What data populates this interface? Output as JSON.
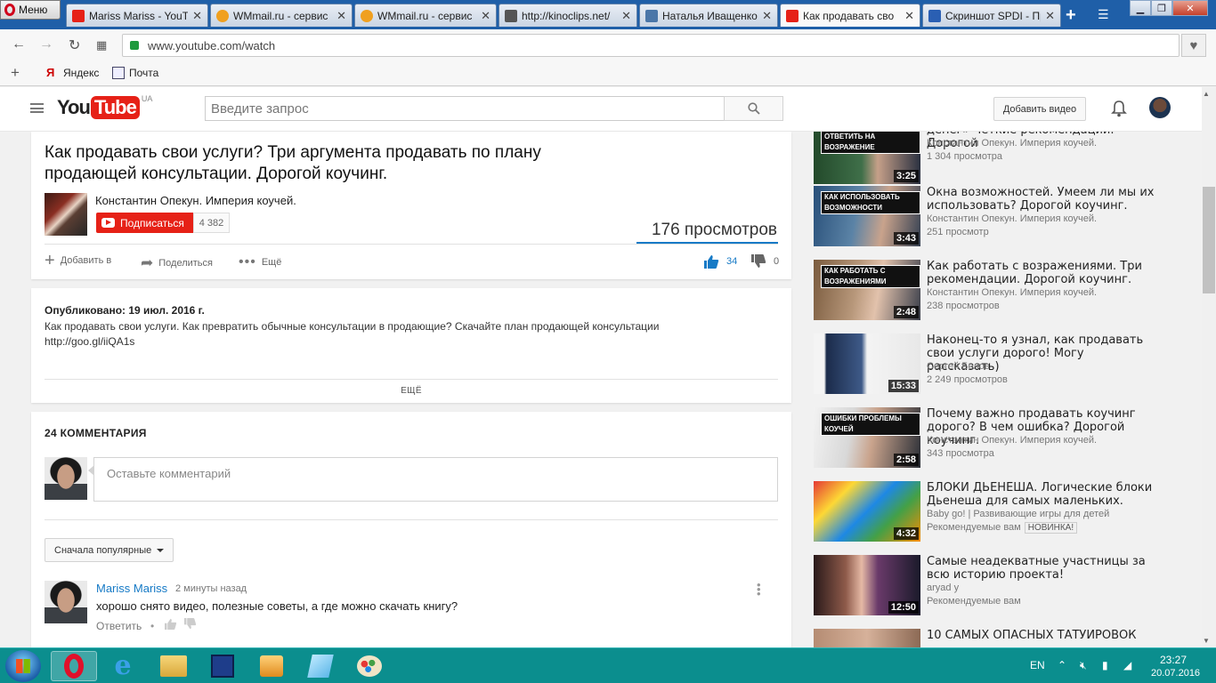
{
  "browser": {
    "menu_label": "Меню",
    "tabs": [
      {
        "label": "Mariss Mariss - YouT",
        "favicon": "youtube-icon",
        "color": "#e62117"
      },
      {
        "label": "WMmail.ru - сервис",
        "favicon": "wmmail-icon",
        "color": "#f0a020"
      },
      {
        "label": "WMmail.ru - сервис",
        "favicon": "wmmail-icon",
        "color": "#f0a020"
      },
      {
        "label": "http://kinoclips.net/",
        "favicon": "kinoclips-icon",
        "color": "#555555"
      },
      {
        "label": "Наталья Иващенко",
        "favicon": "vk-icon",
        "color": "#4a76a8"
      },
      {
        "label": "Как продавать сво",
        "favicon": "youtube-icon",
        "color": "#e62117"
      },
      {
        "label": "Скриншот SPDI - Пр",
        "favicon": "p-icon",
        "color": "#2a5fb3"
      }
    ],
    "active_tab_index": 5,
    "url": "www.youtube.com/watch",
    "bookmarks": [
      {
        "label": "Яндекс",
        "icon": "yandex-icon"
      },
      {
        "label": "Почта",
        "icon": "mail-icon"
      }
    ]
  },
  "youtube": {
    "logo_you": "You",
    "logo_tube": "Tube",
    "logo_region": "UA",
    "search_placeholder": "Введите запрос",
    "upload_label": "Добавить видео",
    "brand_color": "#e62117",
    "link_color": "#167ac6"
  },
  "video": {
    "title": "Как продавать свои услуги? Три аргумента продавать по плану продающей консультации. Дорогой коучинг.",
    "channel": "Константин Опекун. Империя коучей.",
    "subscribe_label": "Подписаться",
    "subscriber_count": "4 382",
    "views": "176 просмотров",
    "actions": {
      "add": "Добавить в",
      "share": "Поделиться",
      "more": "Ещё"
    },
    "likes": "34",
    "dislikes": "0",
    "like_ratio": 1.0
  },
  "description": {
    "published": "Опубликовано: 19 июл. 2016 г.",
    "text": "Как продавать свои услуги. Как превратить обычные консультации в продающие? Скачайте план продающей консультации",
    "link": "http://goo.gl/iiQA1s",
    "more_label": "ЕЩЁ"
  },
  "comments": {
    "header": "24 КОММЕНТАРИЯ",
    "input_placeholder": "Оставьте комментарий",
    "sort_label": "Сначала популярные",
    "items": [
      {
        "author": "Mariss Mariss",
        "time": "2 минуты назад",
        "text": "хорошо снято видео, полезные советы, а где можно скачать книгу?",
        "reply_label": "Ответить",
        "separator": "•"
      }
    ]
  },
  "related": [
    {
      "title": "денег» Четкие рекомендации. Дорогой",
      "author": "Константин Опекун. Империя коучей.",
      "meta": "1 304 просмотра",
      "duration": "3:25",
      "overlay": "ОТВЕТИТЬ НА ВОЗРАЖЕНИЕ"
    },
    {
      "title": "Окна возможностей. Умеем ли мы их использовать? Дорогой коучинг.",
      "author": "Константин Опекун. Империя коучей.",
      "meta": "251 просмотр",
      "duration": "3:43",
      "overlay": "КАК ИСПОЛЬЗОВАТЬ ВОЗМОЖНОСТИ"
    },
    {
      "title": "Как работать с возражениями. Три рекомендации. Дорогой коучинг.",
      "author": "Константин Опекун. Империя коучей.",
      "meta": "238 просмотров",
      "duration": "2:48",
      "overlay": "КАК РАБОТАТЬ С ВОЗРАЖЕНИЯМИ"
    },
    {
      "title": "Наконец-то я узнал, как продавать свои услуги дорого! Могу рассказать)",
      "author": "Сергей Белов",
      "meta": "2 249 просмотров",
      "duration": "15:33",
      "overlay": ""
    },
    {
      "title": "Почему важно продавать коучинг дорого? В чем ошибка? Дорогой коучинг.",
      "author": "Константин Опекун. Империя коучей.",
      "meta": "343 просмотра",
      "duration": "2:58",
      "overlay": "ОШИБКИ ПРОБЛЕМЫ КОУЧЕЙ"
    },
    {
      "title": "БЛОКИ ДЬЕНЕША. Логические блоки Дьенеша для самых маленьких.",
      "author": "Baby go! | Развивающие игры для детей",
      "meta": "Рекомендуемые вам",
      "badge": "НОВИНКА!",
      "duration": "4:32",
      "overlay": ""
    },
    {
      "title": "Самые неадекватные участницы за всю историю проекта!",
      "author": "aryad y",
      "meta": "Рекомендуемые вам",
      "duration": "12:50",
      "overlay": ""
    },
    {
      "title": "10 САМЫХ ОПАСНЫХ ТАТУИРОВОК",
      "author": "",
      "meta": "",
      "duration": "",
      "overlay": ""
    }
  ],
  "taskbar": {
    "language": "EN",
    "time": "23:27",
    "date": "20.07.2016",
    "apps": [
      "opera-icon",
      "internet-explorer-icon",
      "file-explorer-icon",
      "save-disk-icon",
      "media-player-icon",
      "notepad-icon",
      "paint-icon"
    ]
  }
}
